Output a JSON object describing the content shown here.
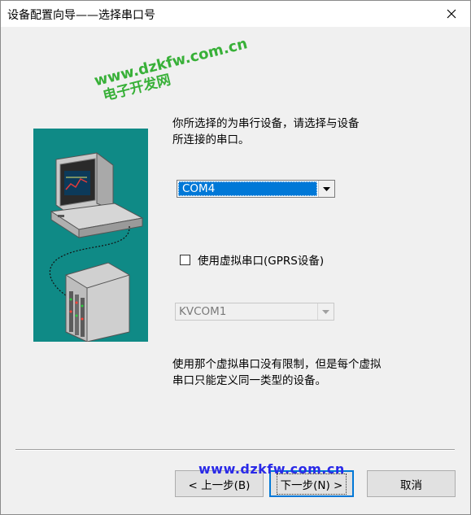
{
  "window": {
    "title": "设备配置向导——选择串口号"
  },
  "watermarks": {
    "site": "www.dzkfw.com.cn",
    "site_cn": "电子开发网",
    "footer_site": "www.dzkfw.com.cn"
  },
  "main": {
    "description_lines": [
      "你所选择的为串行设备，请选择与设备",
      "所连接的串口。"
    ],
    "port_select": {
      "value": "COM4"
    },
    "virtual_checkbox": {
      "label": "使用虚拟串口(GPRS设备)",
      "checked": false
    },
    "virtual_select": {
      "value": "KVCOM1"
    },
    "note_lines": [
      "使用那个虚拟串口没有限制，但是每个虚拟",
      "串口只能定义同一类型的设备。"
    ]
  },
  "footer": {
    "back_label": "< 上一步(B)",
    "next_label": "下一步(N) >",
    "cancel_label": "取消"
  },
  "colors": {
    "illustration_bg": "#0f8a86",
    "selection": "#0078d7",
    "watermark_top": "#19a619",
    "watermark_bottom": "#2a2ae8"
  }
}
